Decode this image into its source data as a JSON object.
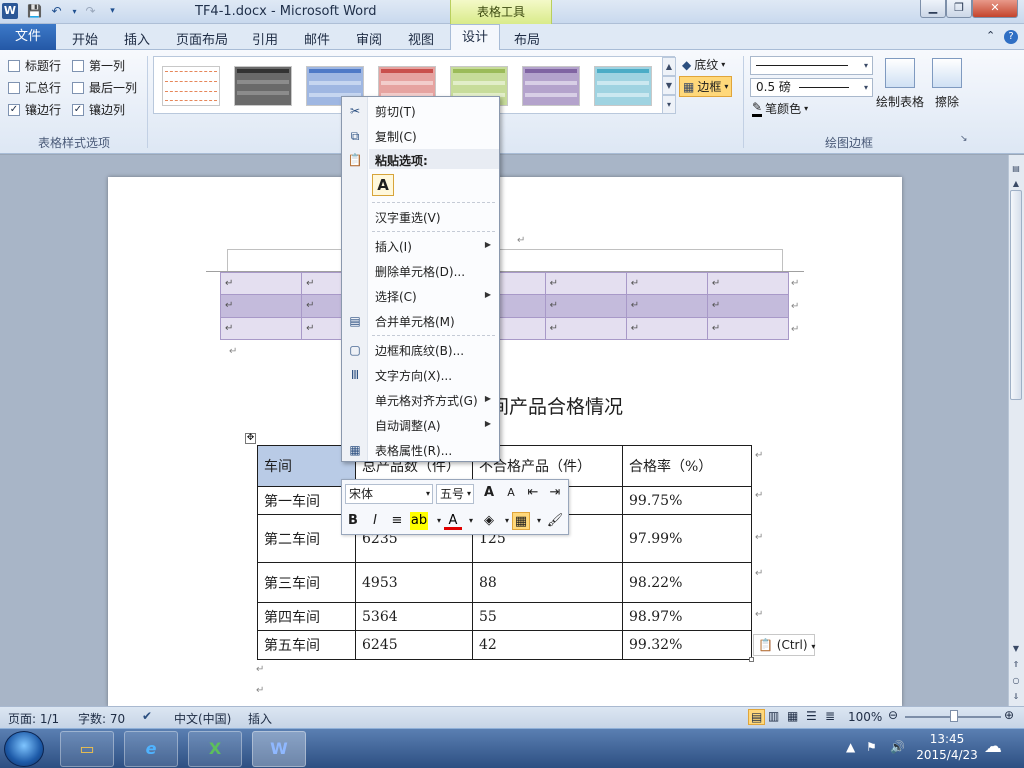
{
  "titlebar": {
    "title": "TF4-1.docx - Microsoft Word",
    "contextual_tab": "表格工具",
    "word_logo": "W"
  },
  "tabs": {
    "file": "文件",
    "items": [
      "开始",
      "插入",
      "页面布局",
      "引用",
      "邮件",
      "审阅",
      "视图",
      "设计",
      "布局"
    ]
  },
  "ribbon": {
    "style_options": {
      "label": "表格样式选项",
      "header_row": "标题行",
      "first_column": "第一列",
      "total_row": "汇总行",
      "last_column": "最后一列",
      "banded_rows": "镶边行",
      "banded_columns": "镶边列",
      "checked_mark": "✓"
    },
    "shading": "底纹",
    "borders": "边框",
    "draw_borders": {
      "label": "绘图边框",
      "pen_weight": "0.5 磅",
      "pen_color": "笔颜色",
      "draw_table": "绘制表格",
      "eraser": "擦除"
    }
  },
  "context_menu": {
    "cut": "剪切(T)",
    "copy": "复制(C)",
    "paste_options": "粘贴选项:",
    "paste_keep_text": "A",
    "reconvert": "汉字重选(V)",
    "insert": "插入(I)",
    "delete_cells": "删除单元格(D)...",
    "select": "选择(C)",
    "merge_cells": "合并单元格(M)",
    "borders_shading": "边框和底纹(B)...",
    "text_direction": "文字方向(X)...",
    "cell_alignment": "单元格对齐方式(G)",
    "autofit": "自动调整(A)",
    "table_properties": "表格属性(R)..."
  },
  "mini_toolbar": {
    "font": "宋体",
    "size": "五号",
    "bold": "B",
    "italic": "I"
  },
  "document": {
    "title_partial": "间产品合格情况",
    "table": {
      "headers": [
        "车间",
        "总产品数（件）",
        "不合格产品（件）",
        "合格率（%）"
      ],
      "rows": [
        [
          "第一车间",
          "",
          "",
          "99.75%"
        ],
        [
          "第二车间",
          "6235",
          "125",
          "97.99%"
        ],
        [
          "第三车间",
          "4953",
          "88",
          "98.22%"
        ],
        [
          "第四车间",
          "5364",
          "55",
          "98.97%"
        ],
        [
          "第五车间",
          "6245",
          "42",
          "99.32%"
        ]
      ]
    },
    "paste_tag": "(Ctrl)"
  },
  "statusbar": {
    "page": "页面: 1/1",
    "words": "字数: 70",
    "language": "中文(中国)",
    "mode": "插入",
    "zoom": "100%"
  },
  "taskbar": {
    "time": "13:45",
    "date": "2015/4/23"
  }
}
